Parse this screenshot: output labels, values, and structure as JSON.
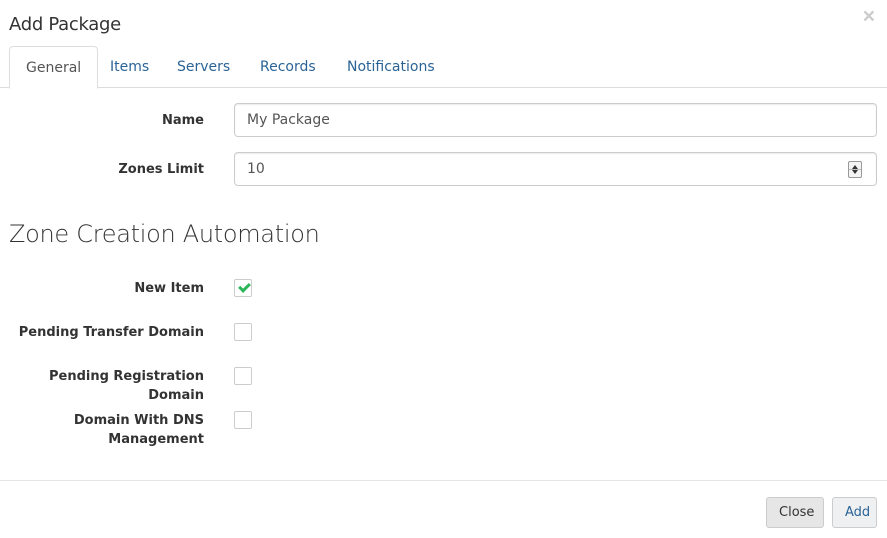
{
  "modal": {
    "title": "Add Package",
    "close_glyph": "×"
  },
  "tabs": [
    {
      "label": "General",
      "active": true
    },
    {
      "label": "Items",
      "active": false
    },
    {
      "label": "Servers",
      "active": false
    },
    {
      "label": "Records",
      "active": false
    },
    {
      "label": "Notifications",
      "active": false
    }
  ],
  "form": {
    "name": {
      "label": "Name",
      "value": "My Package"
    },
    "zones_limit": {
      "label": "Zones Limit",
      "value": "10"
    }
  },
  "automation": {
    "title": "Zone Creation Automation",
    "options": [
      {
        "label": "New Item",
        "checked": true
      },
      {
        "label": "Pending Transfer Domain",
        "checked": false
      },
      {
        "label": "Pending Registration Domain",
        "checked": false
      },
      {
        "label_line1": "Domain With DNS",
        "label_line2": "Management",
        "checked": false
      }
    ]
  },
  "footer": {
    "close_label": "Close",
    "add_label": "Add"
  },
  "colors": {
    "link": "#2a6496",
    "check": "#2cb65a"
  }
}
